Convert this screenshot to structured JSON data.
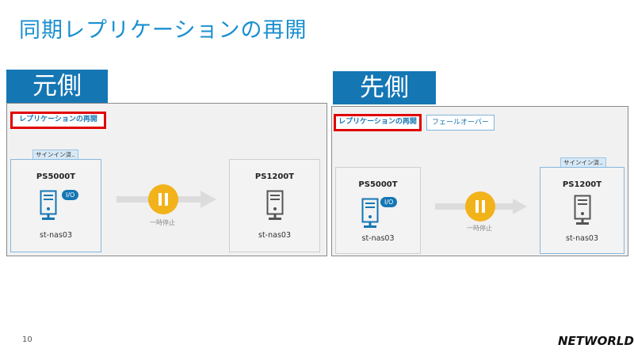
{
  "slide": {
    "title": "同期レプリケーションの再開",
    "page_number": "10",
    "logo_text": "NETWORLD"
  },
  "source": {
    "label": "元側",
    "resume_button": "レプリケーションの再開",
    "signed_in_badge": "サインイン済..",
    "local": {
      "model": "PS5000T",
      "io_badge": "I/O",
      "hostname": "st-nas03"
    },
    "status": "一時停止",
    "remote": {
      "model": "PS1200T",
      "hostname": "st-nas03"
    }
  },
  "target": {
    "label": "先側",
    "resume_button": "レプリケーションの再開",
    "failover_button": "フェールオーバー",
    "signed_in_badge": "サインイン済..",
    "local": {
      "model": "PS5000T",
      "io_badge": "I/O",
      "hostname": "st-nas03"
    },
    "status": "一時停止",
    "remote": {
      "model": "PS1200T",
      "hostname": "st-nas03"
    }
  },
  "colors": {
    "accent": "#1576b4",
    "title": "#1a8fd0",
    "highlight": "#e00000",
    "pause": "#f2b21a",
    "server_active": "#1576b4",
    "server_idle": "#555555"
  }
}
